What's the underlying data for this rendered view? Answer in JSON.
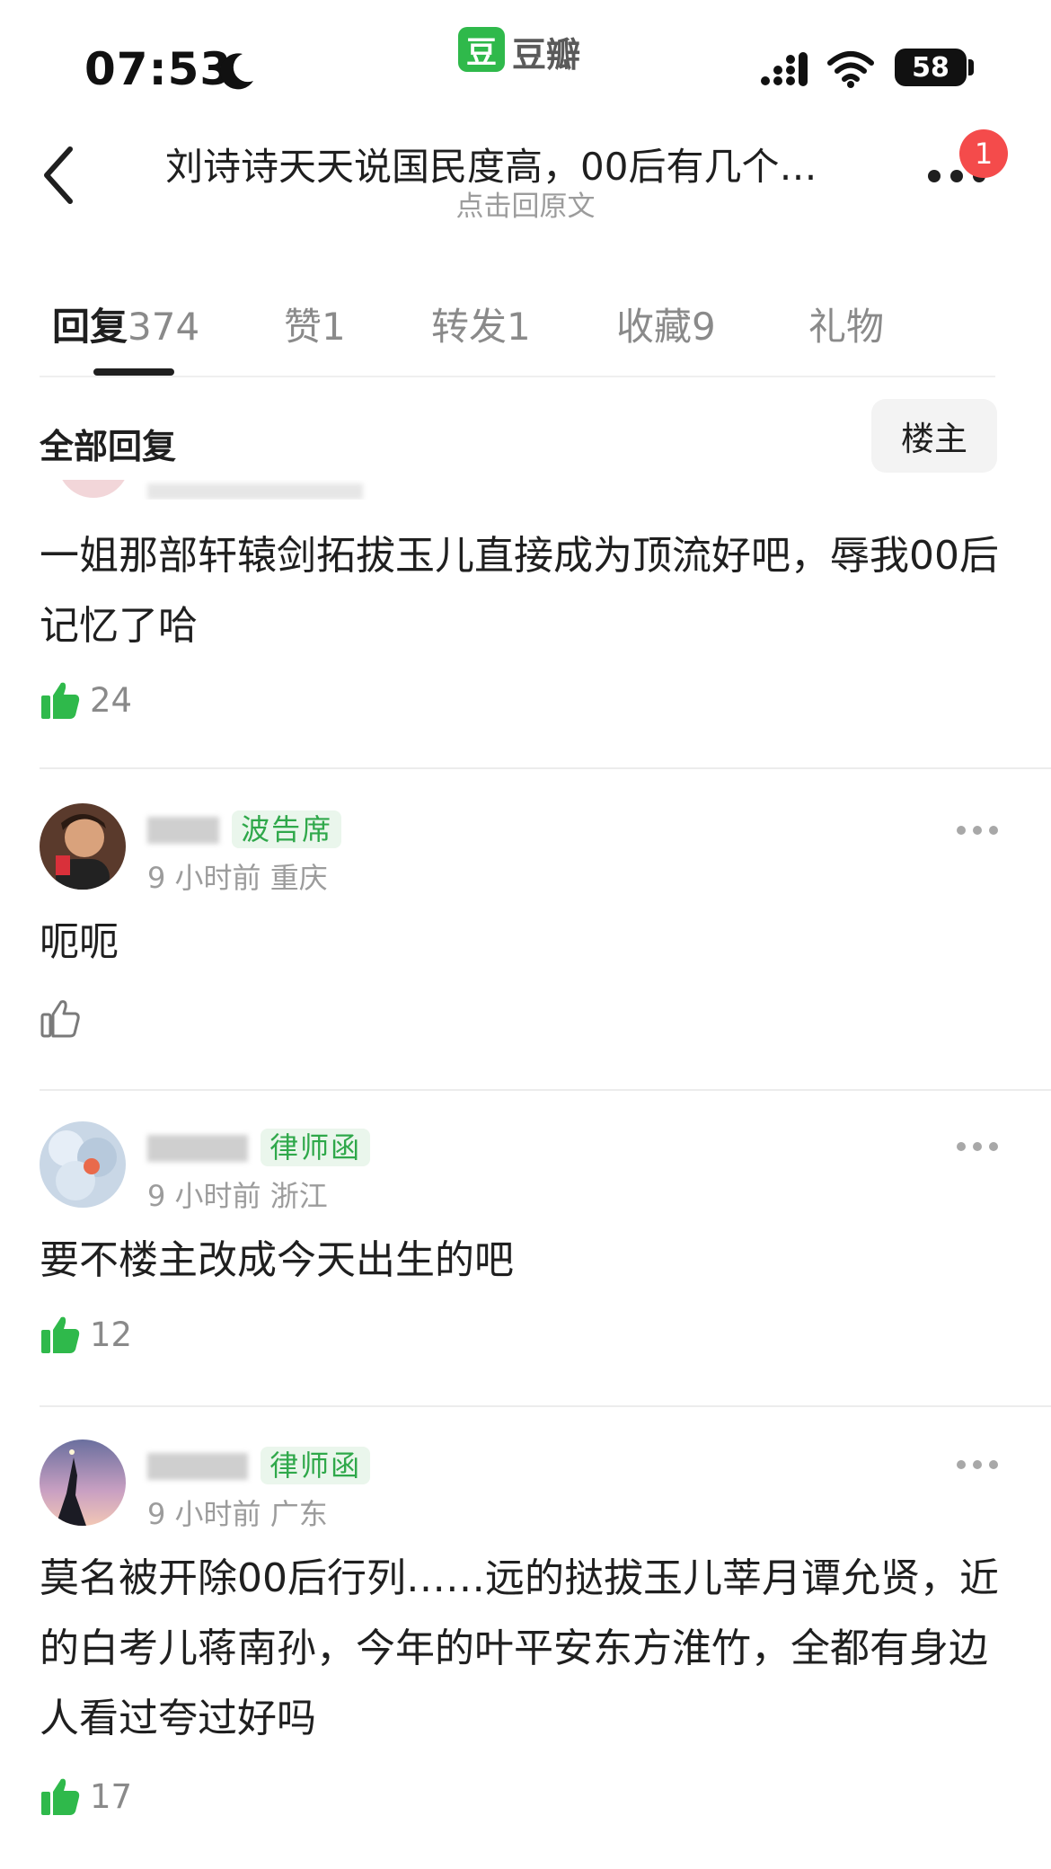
{
  "status_bar": {
    "time": "07:53",
    "app_badge": "豆",
    "app_name": "豆瓣",
    "battery": "58"
  },
  "nav": {
    "title": "刘诗诗天天说国民度高，00后有几个…",
    "subtitle": "点击回原文",
    "notification_count": "1"
  },
  "tabs": [
    {
      "name": "回复",
      "count": "374"
    },
    {
      "name": "赞",
      "count": "1"
    },
    {
      "name": "转发",
      "count": "1"
    },
    {
      "name": "收藏",
      "count": "9"
    },
    {
      "name": "礼物",
      "count": ""
    }
  ],
  "filter": {
    "label": "全部回复",
    "op_button": "楼主"
  },
  "comments": [
    {
      "text": "一姐那部轩辕剑拓拔玉儿直接成为顶流好吧，辱我00后记忆了哈",
      "likes": "24",
      "liked": true
    },
    {
      "username": "",
      "tag": "波告席",
      "time": "9 小时前",
      "location": "重庆",
      "text": "呃呃",
      "likes": "",
      "liked": false
    },
    {
      "username": "",
      "tag": "律师函",
      "time": "9 小时前",
      "location": "浙江",
      "text": "要不楼主改成今天出生的吧",
      "likes": "12",
      "liked": true
    },
    {
      "username": "",
      "tag": "律师函",
      "time": "9 小时前",
      "location": "广东",
      "text": "莫名被开除00后行列……远的挞拔玉儿莘月谭允贤，近的白考儿蒋南孙，今年的叶平安东方淮竹，全都有身边人看过夸过好吗",
      "likes": "17",
      "liked": true
    }
  ],
  "colors": {
    "brand_green": "#2fb94b",
    "tag_green": "#2fa84a",
    "badge_red": "#f44b4b"
  }
}
